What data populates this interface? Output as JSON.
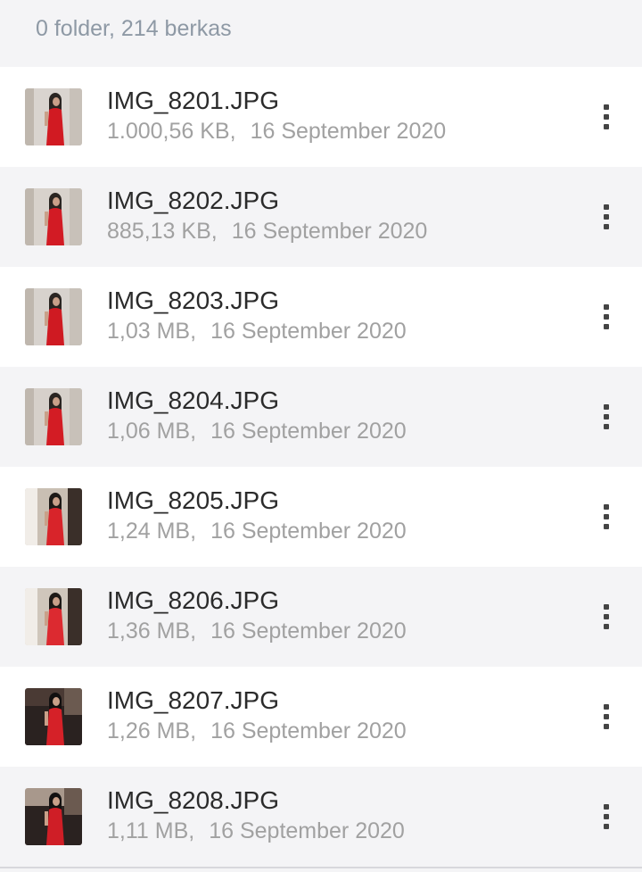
{
  "header": {
    "summary": "0 folder, 214 berkas"
  },
  "files": [
    {
      "name": "IMG_8201.JPG",
      "size": "1.000,56 KB,",
      "date": "16 September 2020",
      "thumb": {
        "bg": "#d9d4cf",
        "dark": "#2a2522",
        "dress": "#d11a22",
        "variant": "wall"
      }
    },
    {
      "name": "IMG_8202.JPG",
      "size": "885,13 KB,",
      "date": "16 September 2020",
      "thumb": {
        "bg": "#d8d2cc",
        "dark": "#2a2522",
        "dress": "#d21b24",
        "variant": "wall"
      }
    },
    {
      "name": "IMG_8203.JPG",
      "size": "1,03 MB,",
      "date": "16 September 2020",
      "thumb": {
        "bg": "#d7d2cd",
        "dark": "#2a2522",
        "dress": "#cf1a22",
        "variant": "wall"
      }
    },
    {
      "name": "IMG_8204.JPG",
      "size": "1,06 MB,",
      "date": "16 September 2020",
      "thumb": {
        "bg": "#d6d0ca",
        "dark": "#2a2522",
        "dress": "#d31c24",
        "variant": "wall"
      }
    },
    {
      "name": "IMG_8205.JPG",
      "size": "1,24 MB,",
      "date": "16 September 2020",
      "thumb": {
        "bg": "#c9bfb3",
        "dark": "#1e1a17",
        "dress": "#d8242a",
        "variant": "room"
      }
    },
    {
      "name": "IMG_8206.JPG",
      "size": "1,36 MB,",
      "date": "16 September 2020",
      "thumb": {
        "bg": "#cfc6bb",
        "dark": "#1e1a17",
        "dress": "#dc2a30",
        "variant": "room"
      }
    },
    {
      "name": "IMG_8207.JPG",
      "size": "1,26 MB,",
      "date": "16 September 2020",
      "thumb": {
        "bg": "#4a3a34",
        "dark": "#121010",
        "dress": "#d52128",
        "variant": "dark"
      }
    },
    {
      "name": "IMG_8208.JPG",
      "size": "1,11 MB,",
      "date": "16 September 2020",
      "thumb": {
        "bg": "#a8988c",
        "dark": "#141212",
        "dress": "#cf1e26",
        "variant": "dark"
      }
    }
  ],
  "icons": {
    "thumbnail": "image-thumbnail",
    "more": "more-vertical-icon"
  },
  "colors": {
    "row_light": "#ffffff",
    "row_shade": "#f4f4f6",
    "filename": "#2b2b2b",
    "meta": "#a1a1a1",
    "summary": "#8e99a5"
  }
}
